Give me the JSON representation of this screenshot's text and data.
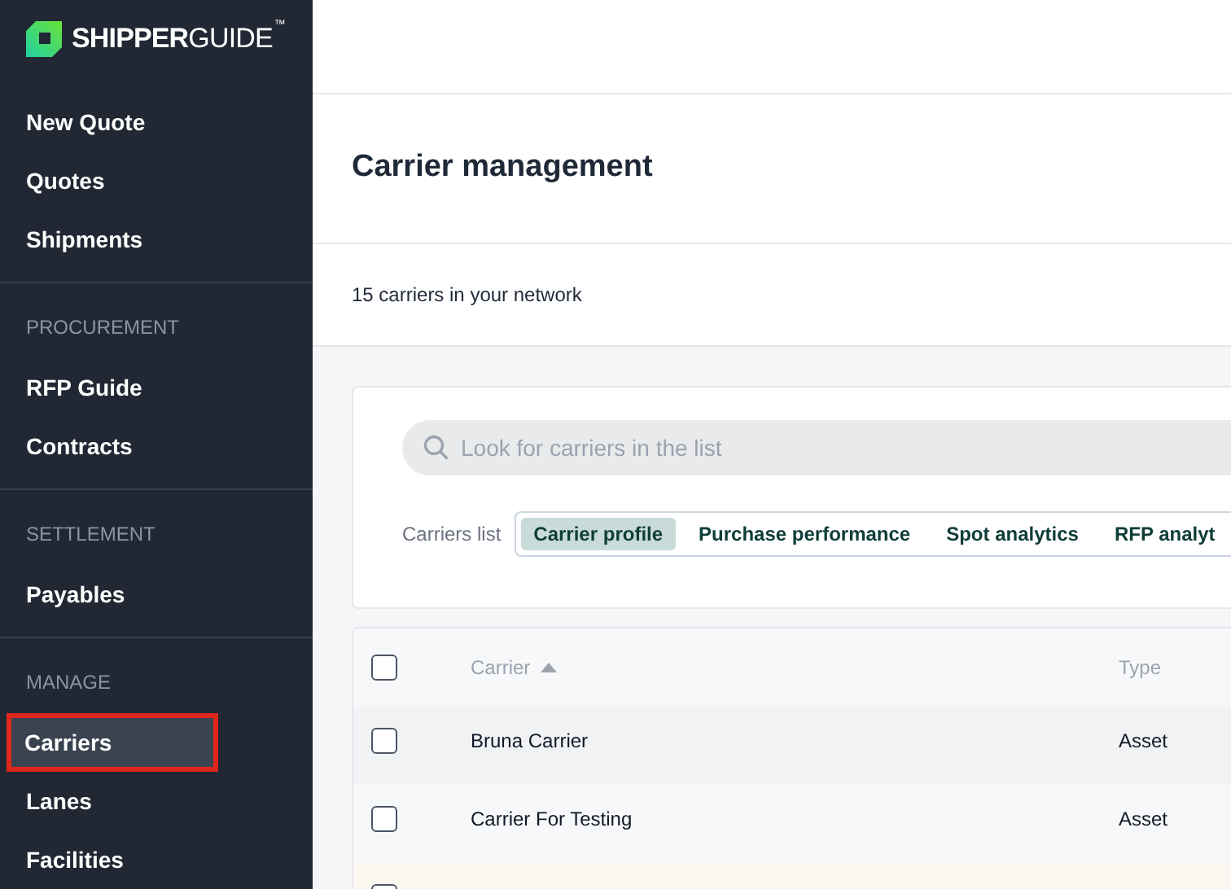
{
  "logo": {
    "bold": "SHIPPER",
    "light": "GUIDE",
    "mark": "™"
  },
  "sidebar": {
    "sections": [
      {
        "items": [
          {
            "label": "New Quote",
            "selected": false,
            "highlighted": false
          },
          {
            "label": "Quotes",
            "selected": false,
            "highlighted": false
          },
          {
            "label": "Shipments",
            "selected": false,
            "highlighted": false
          }
        ]
      },
      {
        "heading": "PROCUREMENT",
        "items": [
          {
            "label": "RFP Guide",
            "selected": false,
            "highlighted": false
          },
          {
            "label": "Contracts",
            "selected": false,
            "highlighted": false
          }
        ]
      },
      {
        "heading": "SETTLEMENT",
        "items": [
          {
            "label": "Payables",
            "selected": false,
            "highlighted": false
          }
        ]
      },
      {
        "heading": "MANAGE",
        "items": [
          {
            "label": "Carriers",
            "selected": true,
            "highlighted": true
          },
          {
            "label": "Lanes",
            "selected": false,
            "highlighted": false
          },
          {
            "label": "Facilities",
            "selected": false,
            "highlighted": false
          }
        ]
      }
    ]
  },
  "page_title": "Carrier management",
  "summary": "15 carriers in your network",
  "search": {
    "placeholder": "Look for carriers in the list"
  },
  "view_switch": {
    "label": "Carriers list",
    "tabs": [
      {
        "label": "Carrier profile",
        "selected": true
      },
      {
        "label": "Purchase performance",
        "selected": false
      },
      {
        "label": "Spot analytics",
        "selected": false
      },
      {
        "label": "RFP analyt",
        "selected": false
      }
    ]
  },
  "table": {
    "select_all": {
      "checked": false
    },
    "columns": [
      {
        "label": "Carrier",
        "sorted": true
      },
      {
        "label": "Type",
        "sorted": false
      }
    ],
    "rows": [
      {
        "carrier": "Bruna Carrier",
        "type": "Asset",
        "checked": false
      },
      {
        "carrier": "Carrier For Testing",
        "type": "Asset",
        "checked": false
      },
      {
        "checked": false
      }
    ]
  }
}
